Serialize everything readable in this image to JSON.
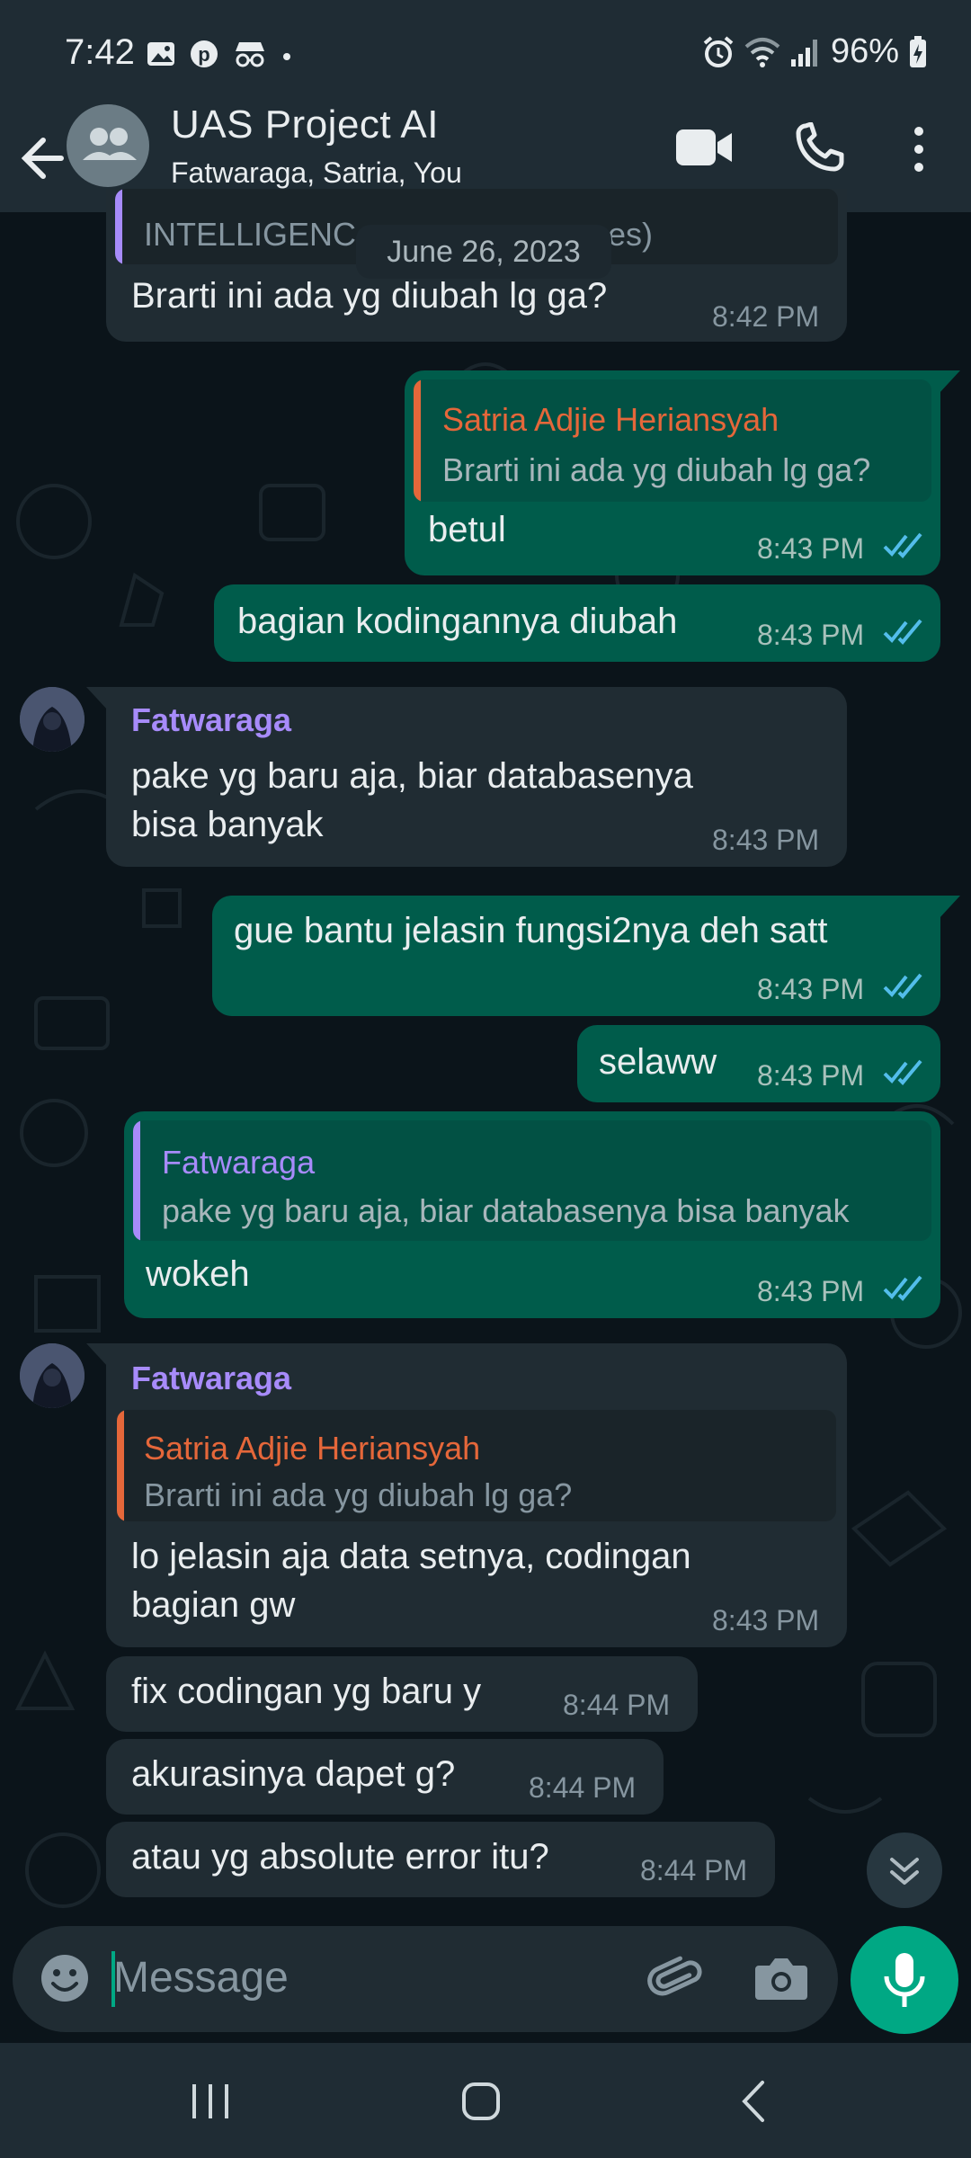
{
  "status_bar": {
    "time": "7:42",
    "battery": "96%"
  },
  "header": {
    "title": "UAS Project AI",
    "subtitle": "Fatwaraga, Satria, You"
  },
  "date_chip": "June 26, 2023",
  "messages": {
    "m0": {
      "quote_text": "INTELLIGENC",
      "quote_tail": "es)",
      "text": "Brarti ini ada yg diubah lg ga?",
      "time": "8:42 PM"
    },
    "m1": {
      "quote_name": "Satria Adjie Heriansyah",
      "quote_text": "Brarti ini ada yg diubah lg ga?",
      "text": "betul",
      "time": "8:43 PM"
    },
    "m2": {
      "text": "bagian kodingannya diubah",
      "time": "8:43 PM"
    },
    "m3": {
      "sender": "Fatwaraga",
      "line1": "pake yg baru aja, biar databasenya",
      "line2": "bisa banyak",
      "time": "8:43 PM"
    },
    "m4": {
      "text": "gue bantu jelasin fungsi2nya deh satt",
      "time": "8:43 PM"
    },
    "m5": {
      "text": "selaww",
      "time": "8:43 PM"
    },
    "m6": {
      "quote_name": "Fatwaraga",
      "quote_text": "pake yg baru aja, biar databasenya bisa banyak",
      "text": "wokeh",
      "time": "8:43 PM"
    },
    "m7": {
      "sender": "Fatwaraga",
      "quote_name": "Satria Adjie Heriansyah",
      "quote_text": "Brarti ini ada yg diubah lg ga?",
      "line1": "lo jelasin aja data setnya, codingan",
      "line2": "bagian gw",
      "time": "8:43 PM"
    },
    "m8": {
      "text": "fix codingan yg baru y",
      "time": "8:44 PM"
    },
    "m9": {
      "text": "akurasinya dapet g?",
      "time": "8:44 PM"
    },
    "m10": {
      "text": "atau yg absolute error itu?",
      "time": "8:44 PM"
    }
  },
  "input": {
    "placeholder": "Message"
  },
  "colors": {
    "background": "#0b141a",
    "bar": "#1f2c34",
    "incoming": "#202c33",
    "outgoing": "#005c4b",
    "accent": "#00a884",
    "read_ticks": "#53bdeb",
    "sender_purple": "#a78bfa",
    "quote_orange": "#e5673a"
  },
  "icons": [
    "back-arrow-icon",
    "group-avatar-icon",
    "video-call-icon",
    "phone-icon",
    "more-vert-icon",
    "double-check-icon",
    "chevrons-down-icon",
    "emoji-icon",
    "attach-icon",
    "camera-icon",
    "mic-icon"
  ]
}
